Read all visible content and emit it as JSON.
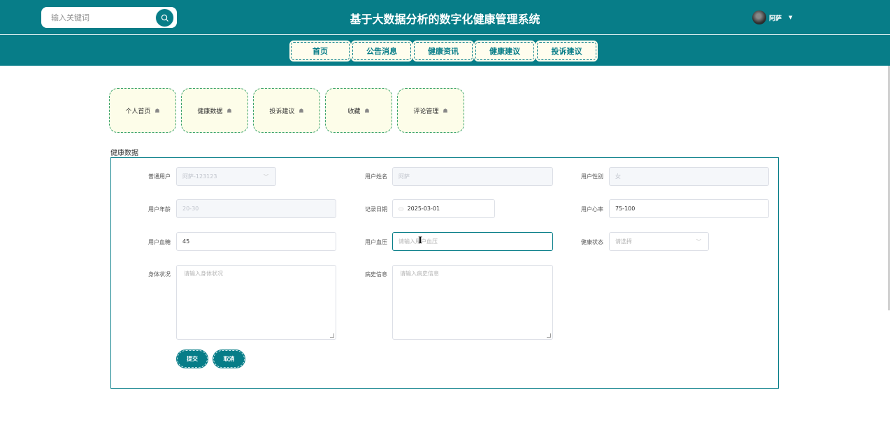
{
  "header": {
    "search": {
      "placeholder": "输入关键词"
    },
    "title": "基于大数据分析的数字化健康管理系统",
    "user": {
      "name": "阿萨"
    }
  },
  "nav": {
    "items": [
      {
        "label": "首页"
      },
      {
        "label": "公告消息"
      },
      {
        "label": "健康资讯"
      },
      {
        "label": "健康建议"
      },
      {
        "label": "投诉建议"
      }
    ]
  },
  "center_tabs": [
    {
      "label": "个人首页"
    },
    {
      "label": "健康数据"
    },
    {
      "label": "投诉建议"
    },
    {
      "label": "收藏"
    },
    {
      "label": "评论管理"
    }
  ],
  "section_title": "健康数据",
  "form": {
    "user_select": {
      "label": "普通用户",
      "value": "阿萨-123123"
    },
    "user_name": {
      "label": "用户姓名",
      "value": "阿萨"
    },
    "user_gender": {
      "label": "用户性别",
      "value": "女"
    },
    "user_age": {
      "label": "用户年龄",
      "value": "20-30"
    },
    "record_date": {
      "label": "记录日期",
      "value": "2025-03-01"
    },
    "heart_rate": {
      "label": "用户心率",
      "value": "75-100"
    },
    "blood_sugar": {
      "label": "用户血糖",
      "value": "45"
    },
    "blood_pressure": {
      "label": "用户血压",
      "placeholder": "请输入用户血压"
    },
    "health_status": {
      "label": "健康状态",
      "placeholder": "请选择"
    },
    "body_condition": {
      "label": "身体状况",
      "placeholder": "请输入身体状况"
    },
    "medical_history": {
      "label": "病史信息",
      "placeholder": "请输入病史信息"
    },
    "submit_label": "提交",
    "cancel_label": "取消"
  },
  "colors": {
    "primary": "#077d88",
    "card_bg": "#fdfde9",
    "nav_bg": "#fffdee"
  }
}
